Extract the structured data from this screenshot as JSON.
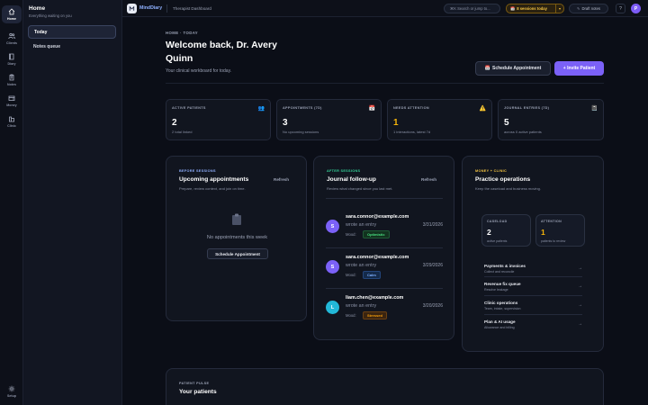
{
  "rail": {
    "items": [
      {
        "label": "Home",
        "icon": "home-icon"
      },
      {
        "label": "Clients",
        "icon": "users-icon"
      },
      {
        "label": "Diary",
        "icon": "book-icon"
      },
      {
        "label": "Notes",
        "icon": "clipboard-icon"
      },
      {
        "label": "Money",
        "icon": "wallet-icon"
      },
      {
        "label": "Clinic",
        "icon": "building-icon"
      },
      {
        "label": "Setup",
        "icon": "gear-icon"
      }
    ]
  },
  "side": {
    "title": "Home",
    "subtitle": "Everything waiting on you",
    "items": [
      {
        "label": "Today"
      },
      {
        "label": "Notes queue"
      }
    ]
  },
  "topbar": {
    "brand": "MindDiary",
    "page": "Therapist Dashboard",
    "search_label": "⌘K Search or jump to...",
    "sessions_label": "8 sessions today",
    "drafts_label": "Draft notes",
    "help_label": "?",
    "avatar_initial": "P"
  },
  "main": {
    "breadcrumb": "HOME · TODAY",
    "welcome": "Welcome back, Dr. Avery Quinn",
    "subtitle": "Your clinical workboard for today.",
    "schedule_btn": "Schedule Appointment",
    "invite_btn": "+ Invite Patient"
  },
  "stats": [
    {
      "label": "ACTIVE PATIENTS",
      "value": "2",
      "sub": "2 total linked",
      "icon": "👥"
    },
    {
      "label": "APPOINTMENTS (7D)",
      "value": "3",
      "sub": "No upcoming sessions",
      "icon": "📅"
    },
    {
      "label": "NEEDS ATTENTION",
      "value": "1",
      "sub": "1 interactions, latest 7d",
      "icon": "⚠️"
    },
    {
      "label": "JOURNAL ENTRIES (7D)",
      "value": "5",
      "sub": "across 0 active patients",
      "icon": "📓"
    }
  ],
  "upcoming": {
    "eyebrow": "BEFORE SESSIONS",
    "title": "Upcoming appointments",
    "sub": "Prepare, review context, and join on time.",
    "refresh": "Refresh",
    "empty_text": "No appointments this week",
    "empty_btn": "Schedule Appointment"
  },
  "journal": {
    "eyebrow": "AFTER SESSIONS",
    "title": "Journal follow-up",
    "sub": "Review what changed since you last met.",
    "refresh": "Refresh",
    "mood_label": "Mood:",
    "entries": [
      {
        "initial": "S",
        "email": "sara.connor@example.com",
        "action": "wrote an entry",
        "mood": "Optimistic",
        "date": "3/31/2026"
      },
      {
        "initial": "S",
        "email": "sara.connor@example.com",
        "action": "wrote an entry",
        "mood": "Calm",
        "date": "3/29/2026"
      },
      {
        "initial": "L",
        "email": "liam.chen@example.com",
        "action": "wrote an entry",
        "mood": "Stressed",
        "date": "3/20/2026"
      }
    ]
  },
  "practice": {
    "eyebrow": "MONEY + CLINIC",
    "title": "Practice operations",
    "sub": "Keep the caseload and business moving.",
    "caseload": {
      "label": "CASELOAD",
      "value": "2",
      "sub": "active patients"
    },
    "attention": {
      "label": "ATTENTION",
      "value": "1",
      "sub": "patients to review"
    },
    "ops": [
      {
        "title": "Payments & invoices",
        "sub": "Collect and reconcile",
        "arrow": "→"
      },
      {
        "title": "Revenue fix queue",
        "sub": "Resolve leakage",
        "arrow": "→"
      },
      {
        "title": "Clinic operations",
        "sub": "Team, intake, supervision",
        "arrow": "→"
      },
      {
        "title": "Plan & AI usage",
        "sub": "Allowance and billing",
        "arrow": "→"
      }
    ]
  },
  "pulse": {
    "eyebrow": "PATIENT PULSE",
    "title": "Your patients"
  },
  "colors": {
    "accent": "#7b61f7",
    "warn": "#f5b40a",
    "after": "#34d399",
    "before": "#8fb0ff",
    "money": "#f5c542"
  }
}
